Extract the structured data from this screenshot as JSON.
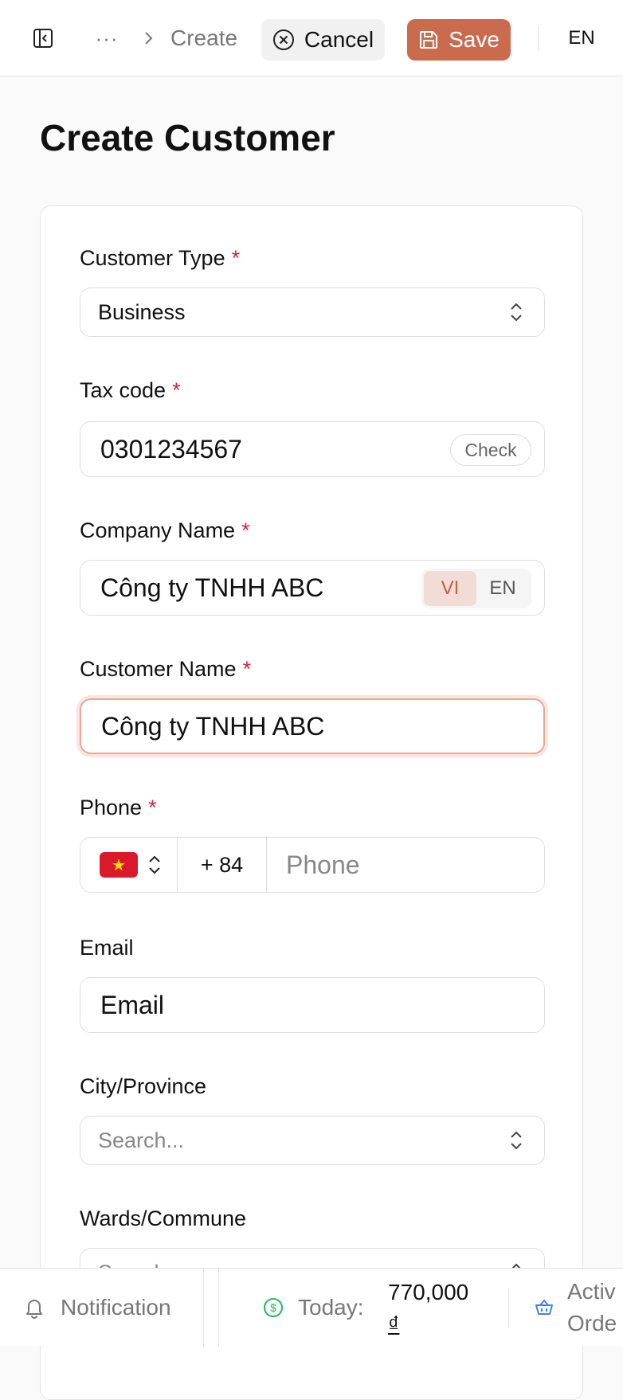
{
  "topbar": {
    "breadcrumb_more": "···",
    "breadcrumb_current": "Create",
    "cancel_label": "Cancel",
    "save_label": "Save",
    "language": "EN"
  },
  "page": {
    "title": "Create Customer"
  },
  "form": {
    "customer_type": {
      "label": "Customer Type",
      "required": "*",
      "value": "Business"
    },
    "tax_code": {
      "label": "Tax code",
      "required": "*",
      "value": "0301234567",
      "check_label": "Check"
    },
    "company_name": {
      "label": "Company Name",
      "required": "*",
      "value": "Công ty TNHH ABC",
      "lang_vi": "VI",
      "lang_en": "EN"
    },
    "customer_name": {
      "label": "Customer Name",
      "required": "*",
      "value": "Công ty TNHH ABC"
    },
    "phone": {
      "label": "Phone",
      "required": "*",
      "country_flag": "vietnam-flag",
      "code": "+ 84",
      "placeholder": "Phone"
    },
    "email": {
      "label": "Email",
      "placeholder": "Email"
    },
    "city": {
      "label": "City/Province",
      "placeholder": "Search..."
    },
    "wards": {
      "label": "Wards/Commune",
      "placeholder": "Search..."
    }
  },
  "bottombar": {
    "notification_label": "Notification",
    "today_label": "Today:",
    "today_amount": "770,000",
    "currency": "₫",
    "active_orders_line1": "Activ",
    "active_orders_line2": "Orde"
  },
  "colors": {
    "accent": "#cb6b4e",
    "required": "#d4243b",
    "money_icon": "#22b85a",
    "orders_icon": "#3b82f6"
  }
}
